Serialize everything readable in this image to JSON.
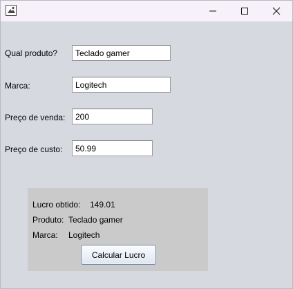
{
  "window": {
    "controls": {
      "minimize": "minimize-icon",
      "maximize": "maximize-icon",
      "close": "close-icon"
    }
  },
  "form": {
    "produto": {
      "label": "Qual produto?",
      "value": "Teclado gamer"
    },
    "marca": {
      "label": "Marca:",
      "value": "Logitech"
    },
    "preco_venda": {
      "label": "Preço de venda:",
      "value": "200"
    },
    "preco_custo": {
      "label": "Preço de custo:",
      "value": "50.99"
    }
  },
  "result": {
    "lucro_label": "Lucro obtido:",
    "lucro_value": "149.01",
    "produto_label": "Produto:",
    "produto_value": "Teclado gamer",
    "marca_label": "Marca:",
    "marca_value": "Logitech",
    "button_label": "Calcular Lucro"
  },
  "colors": {
    "background": "#d6d9df",
    "titlebar": "#f7f2f9",
    "panel": "#cacaca"
  }
}
